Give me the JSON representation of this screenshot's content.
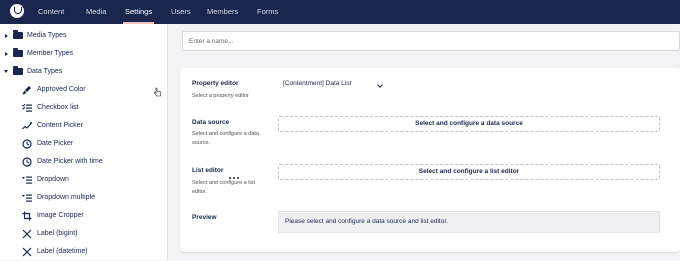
{
  "header": {
    "tabs": [
      {
        "label": "Content"
      },
      {
        "label": "Media"
      },
      {
        "label": "Settings"
      },
      {
        "label": "Users"
      },
      {
        "label": "Members"
      },
      {
        "label": "Forms"
      }
    ],
    "active_tab": "Settings"
  },
  "tree": {
    "sections": [
      {
        "label": "Media Types",
        "icon": "folder-icon",
        "expanded": false
      },
      {
        "label": "Member Types",
        "icon": "folder-icon",
        "expanded": false
      },
      {
        "label": "Data Types",
        "icon": "folder-icon",
        "expanded": true
      }
    ],
    "items": [
      {
        "label": "Approved Color",
        "icon": "paint-brush-icon"
      },
      {
        "label": "Checkbox list",
        "icon": "checkbox-list-icon"
      },
      {
        "label": "Content Picker",
        "icon": "content-picker-icon"
      },
      {
        "label": "Date Picker",
        "icon": "clock-icon"
      },
      {
        "label": "Date Picker with time",
        "icon": "clock-icon"
      },
      {
        "label": "Dropdown",
        "icon": "dropdown-list-icon"
      },
      {
        "label": "Dropdown multiple",
        "icon": "dropdown-list-icon"
      },
      {
        "label": "Image Cropper",
        "icon": "crop-icon"
      },
      {
        "label": "Label (bigint)",
        "icon": "cross-icon"
      },
      {
        "label": "Label (datetime)",
        "icon": "cross-icon"
      }
    ]
  },
  "editor": {
    "name_placeholder": "Enter a name...",
    "property_editor": {
      "label": "Property editor",
      "description": "Select a property editor",
      "value": "[Contentment] Data List"
    },
    "data_source": {
      "label": "Data source",
      "description": "Select and configure a data source.",
      "button": "Select and configure a data source"
    },
    "list_editor": {
      "label": "List editor",
      "description": "Select and configure a list editor.",
      "button": "Select and configure a list editor",
      "menu_icon": "more-dots-icon"
    },
    "preview": {
      "label": "Preview",
      "text": "Please select and configure a data source and list editor."
    }
  },
  "colors": {
    "header_bg": "#1b264f",
    "active_tab_underline": "#f5c1bc",
    "text": "#1b264f"
  }
}
